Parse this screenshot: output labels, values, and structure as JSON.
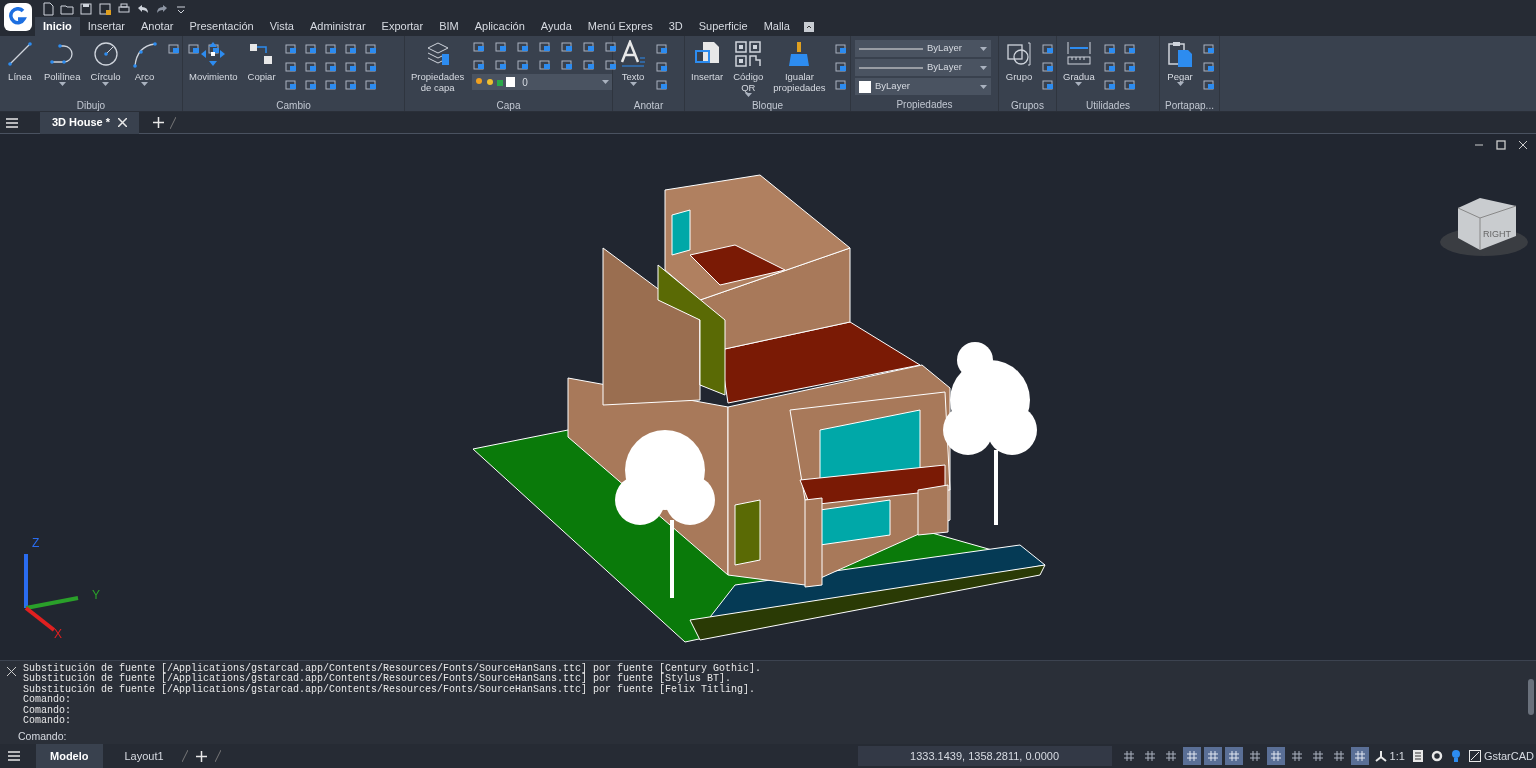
{
  "menu_tabs": [
    {
      "label": "Inicio",
      "selected": true
    },
    {
      "label": "Insertar",
      "selected": false
    },
    {
      "label": "Anotar",
      "selected": false
    },
    {
      "label": "Presentación",
      "selected": false
    },
    {
      "label": "Vista",
      "selected": false
    },
    {
      "label": "Administrar",
      "selected": false
    },
    {
      "label": "Exportar",
      "selected": false
    },
    {
      "label": "BIM",
      "selected": false
    },
    {
      "label": "Aplicación",
      "selected": false
    },
    {
      "label": "Ayuda",
      "selected": false
    },
    {
      "label": "Menú Expres",
      "selected": false
    },
    {
      "label": "3D",
      "selected": false
    },
    {
      "label": "Superficie",
      "selected": false
    },
    {
      "label": "Malla",
      "selected": false
    }
  ],
  "ribbon_panels": [
    {
      "title": "Dibujo",
      "kind": "tools",
      "tools": [
        {
          "label": "Línea",
          "kind": "line",
          "menu": false
        },
        {
          "label": "Polilínea",
          "kind": "polyline",
          "menu": true
        },
        {
          "label": "Círculo",
          "kind": "circle",
          "menu": true
        },
        {
          "label": "Arco",
          "kind": "arc",
          "menu": true
        }
      ]
    },
    {
      "title": "Cambio",
      "kind": "tools",
      "tools": [
        {
          "label": "Movimiento",
          "kind": "move",
          "menu": false
        },
        {
          "label": "Copiar",
          "kind": "copy",
          "menu": false
        }
      ]
    },
    {
      "title": "Capa",
      "kind": "layer",
      "tools": [
        {
          "label": "Propiedades de capa",
          "kind": "layers",
          "menu": false
        }
      ],
      "layer_value": "0"
    },
    {
      "title": "Anotar",
      "kind": "tools",
      "tools": [
        {
          "label": "Texto",
          "kind": "text",
          "menu": true
        }
      ]
    },
    {
      "title": "Bloque",
      "kind": "tools",
      "tools": [
        {
          "label": "Insertar",
          "kind": "insert",
          "menu": false
        },
        {
          "label": "Código QR",
          "kind": "qr",
          "menu": true
        },
        {
          "label": "Igualar propiedades",
          "kind": "brush",
          "menu": false
        }
      ]
    },
    {
      "title": "Propiedades",
      "kind": "properties",
      "dropdowns": [
        {
          "label": "ByLayer",
          "kind": "line"
        },
        {
          "label": "ByLayer",
          "kind": "line"
        },
        {
          "label": "ByLayer",
          "kind": "swatch"
        }
      ]
    },
    {
      "title": "Grupos",
      "kind": "tools",
      "tools": [
        {
          "label": "Grupo",
          "kind": "group",
          "menu": false
        }
      ]
    },
    {
      "title": "Utilidades",
      "kind": "tools",
      "tools": [
        {
          "label": "Gradua",
          "kind": "ruler",
          "menu": true
        }
      ]
    },
    {
      "title": "Portapap...",
      "kind": "tools",
      "tools": [
        {
          "label": "Pegar",
          "kind": "paste",
          "menu": true
        }
      ]
    }
  ],
  "doc_tabs": [
    {
      "label": "3D House *",
      "selected": true
    }
  ],
  "viewport": {
    "cube_label": "RIGHT",
    "axes": [
      "Z",
      "Y",
      "X"
    ]
  },
  "command": {
    "lines": [
      "Substitución de fuente [/Applications/gstarcad.app/Contents/Resources/Fonts/SourceHanSans.ttc] por fuente [Century Gothic].",
      "Substitución de fuente [/Applications/gstarcad.app/Contents/Resources/Fonts/SourceHanSans.ttc] por fuente [Stylus BT].",
      "Substitución de fuente [/Applications/gstarcad.app/Contents/Resources/Fonts/SourceHanSans.ttc] por fuente [Felix Titling].",
      "Comando:",
      "Comando:",
      "Comando:"
    ],
    "prompt": "Comando:"
  },
  "layout_tabs": [
    {
      "label": "Modelo",
      "selected": true
    },
    {
      "label": "Layout1",
      "selected": false
    }
  ],
  "status_bar": {
    "coordinates": "1333.1439, 1358.2811, 0.0000",
    "toggles": [
      {
        "on": false
      },
      {
        "on": false
      },
      {
        "on": false
      },
      {
        "on": true
      },
      {
        "on": true
      },
      {
        "on": true
      },
      {
        "on": false
      },
      {
        "on": true
      },
      {
        "on": false
      },
      {
        "on": false
      },
      {
        "on": false
      },
      {
        "on": true
      }
    ],
    "scale": "1:1",
    "brand": "GstarCAD"
  }
}
